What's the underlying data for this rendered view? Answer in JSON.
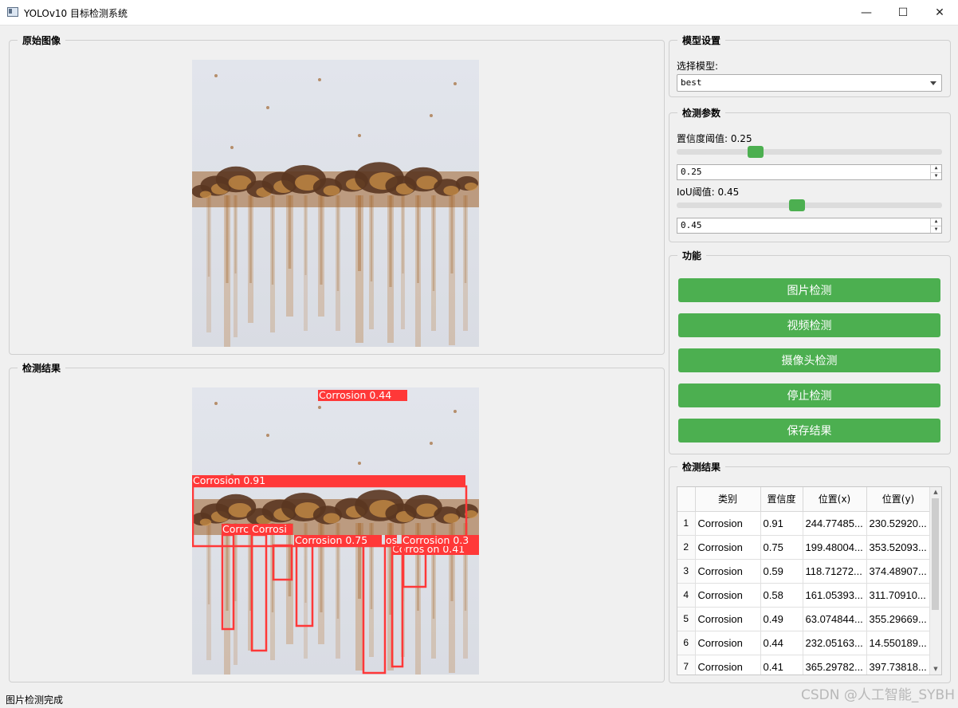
{
  "window": {
    "title": "YOLOv10 目标检测系统",
    "minimize_glyph": "—",
    "maximize_glyph": "☐",
    "close_glyph": "✕"
  },
  "original_panel": {
    "title": "原始图像"
  },
  "result_panel": {
    "title": "检测结果",
    "box_color": "#ff3838",
    "boxes": [
      {
        "label": "Corrosion 0.44"
      },
      {
        "label": "Corrosion 0.91"
      },
      {
        "label": "Corrosion 0.75"
      },
      {
        "label": "Corrosion 0.41"
      },
      {
        "label": "Corrosion 0.3"
      },
      {
        "label": "Corrc"
      },
      {
        "label": "Corrosi"
      },
      {
        "label": "os"
      }
    ]
  },
  "model_settings": {
    "title": "模型设置",
    "select_label": "选择模型:",
    "selected_model": "best"
  },
  "detect_params": {
    "title": "检测参数",
    "conf_label": "置信度阈值: 0.25",
    "conf_value": "0.25",
    "conf_level": 0.25,
    "iou_label": "IoU阈值: 0.45",
    "iou_value": "0.45",
    "iou_level": 0.45,
    "accent": "#4caf50"
  },
  "functions": {
    "title": "功能",
    "buttons": [
      "图片检测",
      "视频检测",
      "摄像头检测",
      "停止检测",
      "保存结果"
    ]
  },
  "results_table": {
    "title": "检测结果",
    "headers": [
      "类别",
      "置信度",
      "位置(x)",
      "位置(y)"
    ],
    "rows": [
      [
        "1",
        "Corrosion",
        "0.91",
        "244.77485...",
        "230.52920..."
      ],
      [
        "2",
        "Corrosion",
        "0.75",
        "199.48004...",
        "353.52093..."
      ],
      [
        "3",
        "Corrosion",
        "0.59",
        "118.71272...",
        "374.48907..."
      ],
      [
        "4",
        "Corrosion",
        "0.58",
        "161.05393...",
        "311.70910..."
      ],
      [
        "5",
        "Corrosion",
        "0.49",
        "63.074844...",
        "355.29669..."
      ],
      [
        "6",
        "Corrosion",
        "0.44",
        "232.05163...",
        "14.550189..."
      ],
      [
        "7",
        "Corrosion",
        "0.41",
        "365.29782...",
        "397.73818..."
      ]
    ]
  },
  "status": {
    "text": "图片检测完成"
  },
  "watermark": {
    "text": "CSDN @人工智能_SYBH"
  }
}
